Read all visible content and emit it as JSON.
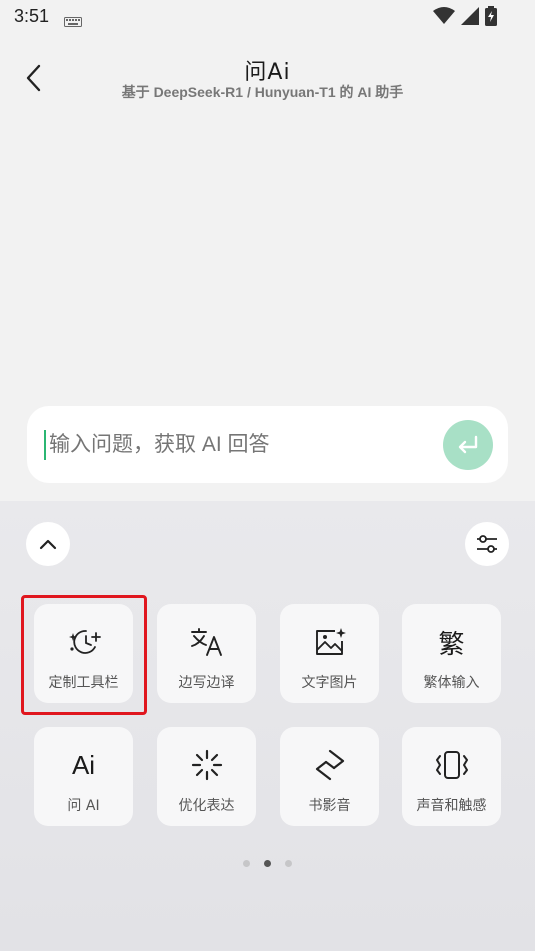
{
  "status_bar": {
    "time": "3:51"
  },
  "header": {
    "title": "问Ai",
    "subtitle": "基于 DeepSeek-R1 / Hunyuan-T1 的 AI 助手"
  },
  "input": {
    "placeholder": "输入问题，获取 AI 回答"
  },
  "toolbar": {
    "tiles": [
      {
        "label": "定制工具栏",
        "icon": "sparkle-clock-icon"
      },
      {
        "label": "边写边译",
        "icon": "translate-icon"
      },
      {
        "label": "文字图片",
        "icon": "image-sparkle-icon"
      },
      {
        "label": "繁体输入",
        "icon": "traditional-char-icon",
        "glyph": "繁"
      },
      {
        "label": "问 AI",
        "icon": "ai-icon",
        "glyph": "Ai"
      },
      {
        "label": "优化表达",
        "icon": "loading-burst-icon"
      },
      {
        "label": "书影音",
        "icon": "book-media-icon"
      },
      {
        "label": "声音和触感",
        "icon": "vibration-icon"
      }
    ],
    "page_count": 3,
    "active_page": 2
  },
  "colors": {
    "accent": "#2bb673",
    "send_button": "#a8e0c6",
    "highlight": "#e0161e"
  }
}
